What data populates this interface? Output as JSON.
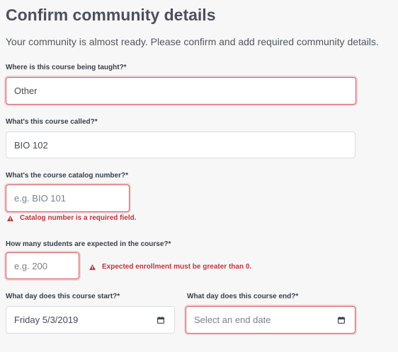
{
  "header": {
    "title": "Confirm community details",
    "subtitle": "Your community is almost ready. Please confirm and add required community details."
  },
  "form": {
    "location": {
      "label": "Where is this course being taught?*",
      "value": "Other",
      "invalid": true
    },
    "course_name": {
      "label": "What's this course called?*",
      "value": "BIO 102"
    },
    "catalog_number": {
      "label": "What's the course catalog number?*",
      "value": "",
      "placeholder": "e.g. BIO 101",
      "error": "Catalog number is a required field."
    },
    "enrollment": {
      "label": "How many students are expected in the course?*",
      "value": "",
      "placeholder": "e.g. 200",
      "error": "Expected enrollment must be greater than 0."
    },
    "start_date": {
      "label": "What day does this course start?*",
      "value": "Friday 5/3/2019",
      "icon": "calendar-icon"
    },
    "end_date": {
      "label": "What day does this course end?*",
      "value": "",
      "placeholder": "Select an end date",
      "icon": "calendar-icon"
    }
  },
  "colors": {
    "error": "#c2343c",
    "invalid_border": "#d75b63",
    "background": "#f7f7f7"
  }
}
